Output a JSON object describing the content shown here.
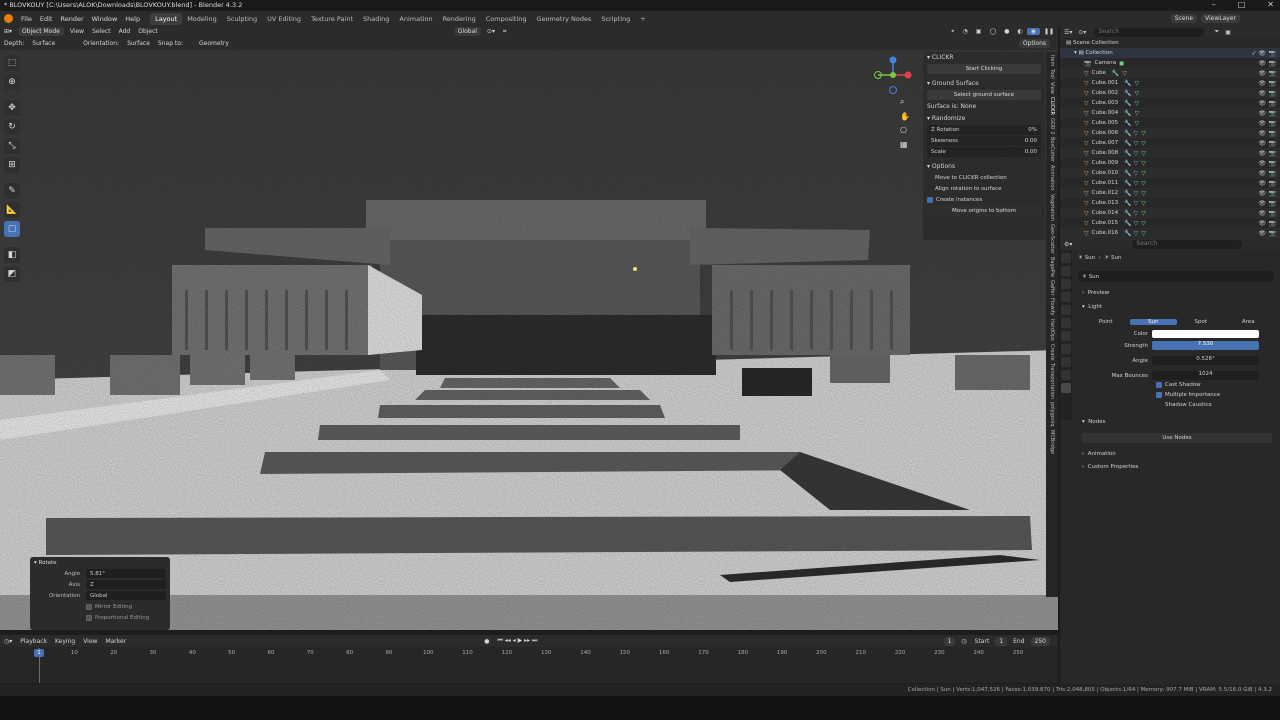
{
  "window": {
    "title": "* BLOVKOUY [C:\\Users\\ALOK\\Downloads\\BLOVKOUY.blend] - Blender 4.3.2",
    "controls": [
      "–",
      "□",
      "✕"
    ]
  },
  "menubar": {
    "menus": [
      "File",
      "Edit",
      "Render",
      "Window",
      "Help"
    ],
    "workspaces": [
      "Layout",
      "Modeling",
      "Sculpting",
      "UV Editing",
      "Texture Paint",
      "Shading",
      "Animation",
      "Rendering",
      "Compositing",
      "Geometry Nodes",
      "Scripting"
    ],
    "active_workspace": "Layout",
    "scene": "Scene",
    "view_layer": "ViewLayer"
  },
  "viewport_header": {
    "mode": "Object Mode",
    "menus": [
      "View",
      "Select",
      "Add",
      "Object"
    ],
    "transform_orientation": "Global",
    "options_label": "Options"
  },
  "tool_header": {
    "depth_label": "Depth:",
    "depth_value": "Surface",
    "orientation_label": "Orientation:",
    "orientation_value": "Surface",
    "snap_label": "Snap to:",
    "snap_value": "Geometry"
  },
  "npanel": {
    "title": "CLICKR",
    "start_button": "Start Clicking",
    "ground_title": "Ground Surface",
    "select_ground": "Select ground surface",
    "surface_status": "Surface is: None",
    "randomize_title": "Randomize",
    "fields": [
      {
        "label": "Z Rotation",
        "value": "0%"
      },
      {
        "label": "Skewness",
        "value": "0.00"
      },
      {
        "label": "Scale",
        "value": "0.00"
      }
    ],
    "options_title": "Options",
    "opt_move": "Move to CLICKR collection",
    "opt_align": "Align rotation to surface",
    "opt_instances": "Create instances",
    "opt_origins": "Move origins to bottom"
  },
  "sidebar_tabs": [
    "Item",
    "Tool",
    "View",
    "CLICKR",
    "GOD 2",
    "BoxCutter",
    "Animation",
    "Vegetation",
    "Geo-Scatter",
    "BagaPie",
    "Gaffer",
    "Flowify",
    "HardOps",
    "Create",
    "Transportation",
    "polygoniq",
    "MCBridge"
  ],
  "active_sidebar_tab": "CLICKR",
  "redo_panel": {
    "title": "Rotate",
    "angle_label": "Angle",
    "angle_value": "5.81°",
    "axis_label": "Axis",
    "axis_value": "Z",
    "orientation_label": "Orientation",
    "orientation_value": "Global",
    "mirror": "Mirror Editing",
    "proportional": "Proportional Editing"
  },
  "timeline": {
    "menus": [
      "Playback",
      "Keying",
      "View",
      "Marker"
    ],
    "current_frame": "1",
    "start_label": "Start",
    "start_value": "1",
    "end_label": "End",
    "end_value": "250",
    "frame_numbers": [
      "1",
      "10",
      "20",
      "30",
      "40",
      "50",
      "60",
      "70",
      "80",
      "90",
      "100",
      "110",
      "120",
      "130",
      "140",
      "150",
      "160",
      "170",
      "180",
      "190",
      "200",
      "210",
      "220",
      "230",
      "240",
      "250"
    ]
  },
  "statusbar": {
    "text": "Collection | Sun | Verts:1,047,526 | Faces:1,039,870 | Tris:2,048,805 | Objects:1/64 | Memory: 907.7 MiB | VRAM: 5.5/16.0 GiB | 4.3.2"
  },
  "outliner": {
    "search_placeholder": "Search",
    "root": "Scene Collection",
    "collection": "Collection",
    "items": [
      "Camera",
      "Cube",
      "Cube.001",
      "Cube.002",
      "Cube.003",
      "Cube.004",
      "Cube.005",
      "Cube.006",
      "Cube.007",
      "Cube.008",
      "Cube.009",
      "Cube.010",
      "Cube.011",
      "Cube.012",
      "Cube.013",
      "Cube.014",
      "Cube.015",
      "Cube.016"
    ]
  },
  "properties": {
    "search_placeholder": "Search",
    "breadcrumb_a": "Sun",
    "breadcrumb_b": "Sun",
    "datablock": "Sun",
    "preview": "Preview",
    "light": "Light",
    "light_types": [
      "Point",
      "Sun",
      "Spot",
      "Area"
    ],
    "active_light_type": "Sun",
    "color_label": "Color",
    "strength_label": "Strength",
    "strength_value": "7.530",
    "angle_label": "Angle",
    "angle_value": "0.526°",
    "bounces_label": "Max Bounces",
    "bounces_value": "1024",
    "cast_shadow": "Cast Shadow",
    "multiple_importance": "Multiple Importance",
    "shadow_caustics": "Shadow Caustics",
    "nodes": "Nodes",
    "use_nodes": "Use Nodes",
    "animation": "Animation",
    "custom_props": "Custom Properties"
  }
}
